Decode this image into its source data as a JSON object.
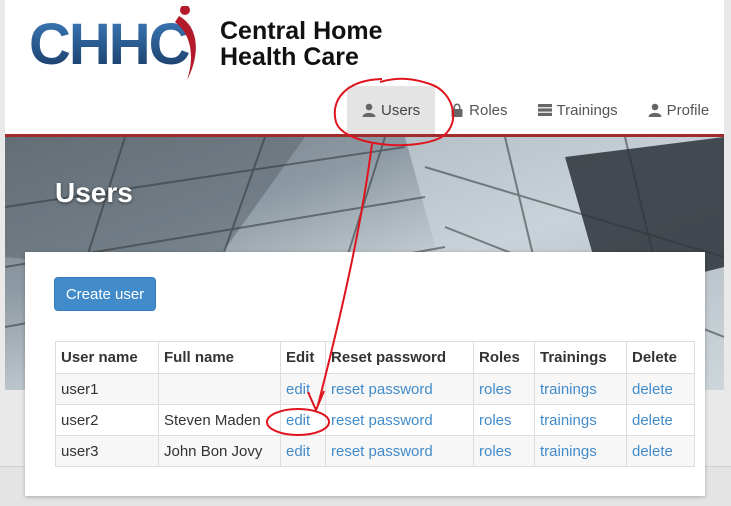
{
  "brand": {
    "logo_text": "CHHC",
    "name_line1": "Central Home",
    "name_line2": "Health Care"
  },
  "nav": {
    "items": [
      {
        "label": "Users",
        "icon": "user-icon",
        "active": true
      },
      {
        "label": "Roles",
        "icon": "lock-icon",
        "active": false
      },
      {
        "label": "Trainings",
        "icon": "server-icon",
        "active": false
      },
      {
        "label": "Profile",
        "icon": "user-icon",
        "active": false
      }
    ]
  },
  "hero": {
    "title": "Users"
  },
  "actions": {
    "create_user_label": "Create user"
  },
  "table": {
    "headers": [
      "User name",
      "Full name",
      "Edit",
      "Reset password",
      "Roles",
      "Trainings",
      "Delete"
    ],
    "rows": [
      {
        "username": "user1",
        "fullname": "",
        "edit": "edit",
        "reset": "reset password",
        "roles": "roles",
        "trainings": "trainings",
        "delete": "delete"
      },
      {
        "username": "user2",
        "fullname": "Steven Maden",
        "edit": "edit",
        "reset": "reset password",
        "roles": "roles",
        "trainings": "trainings",
        "delete": "delete"
      },
      {
        "username": "user3",
        "fullname": "John Bon Jovy",
        "edit": "edit",
        "reset": "reset password",
        "roles": "roles",
        "trainings": "trainings",
        "delete": "delete"
      }
    ]
  },
  "colors": {
    "accent": "#428bca",
    "brand_red": "#a22a2a",
    "logo_blue": "#1f4f86",
    "annotation_red": "#e0141e"
  }
}
